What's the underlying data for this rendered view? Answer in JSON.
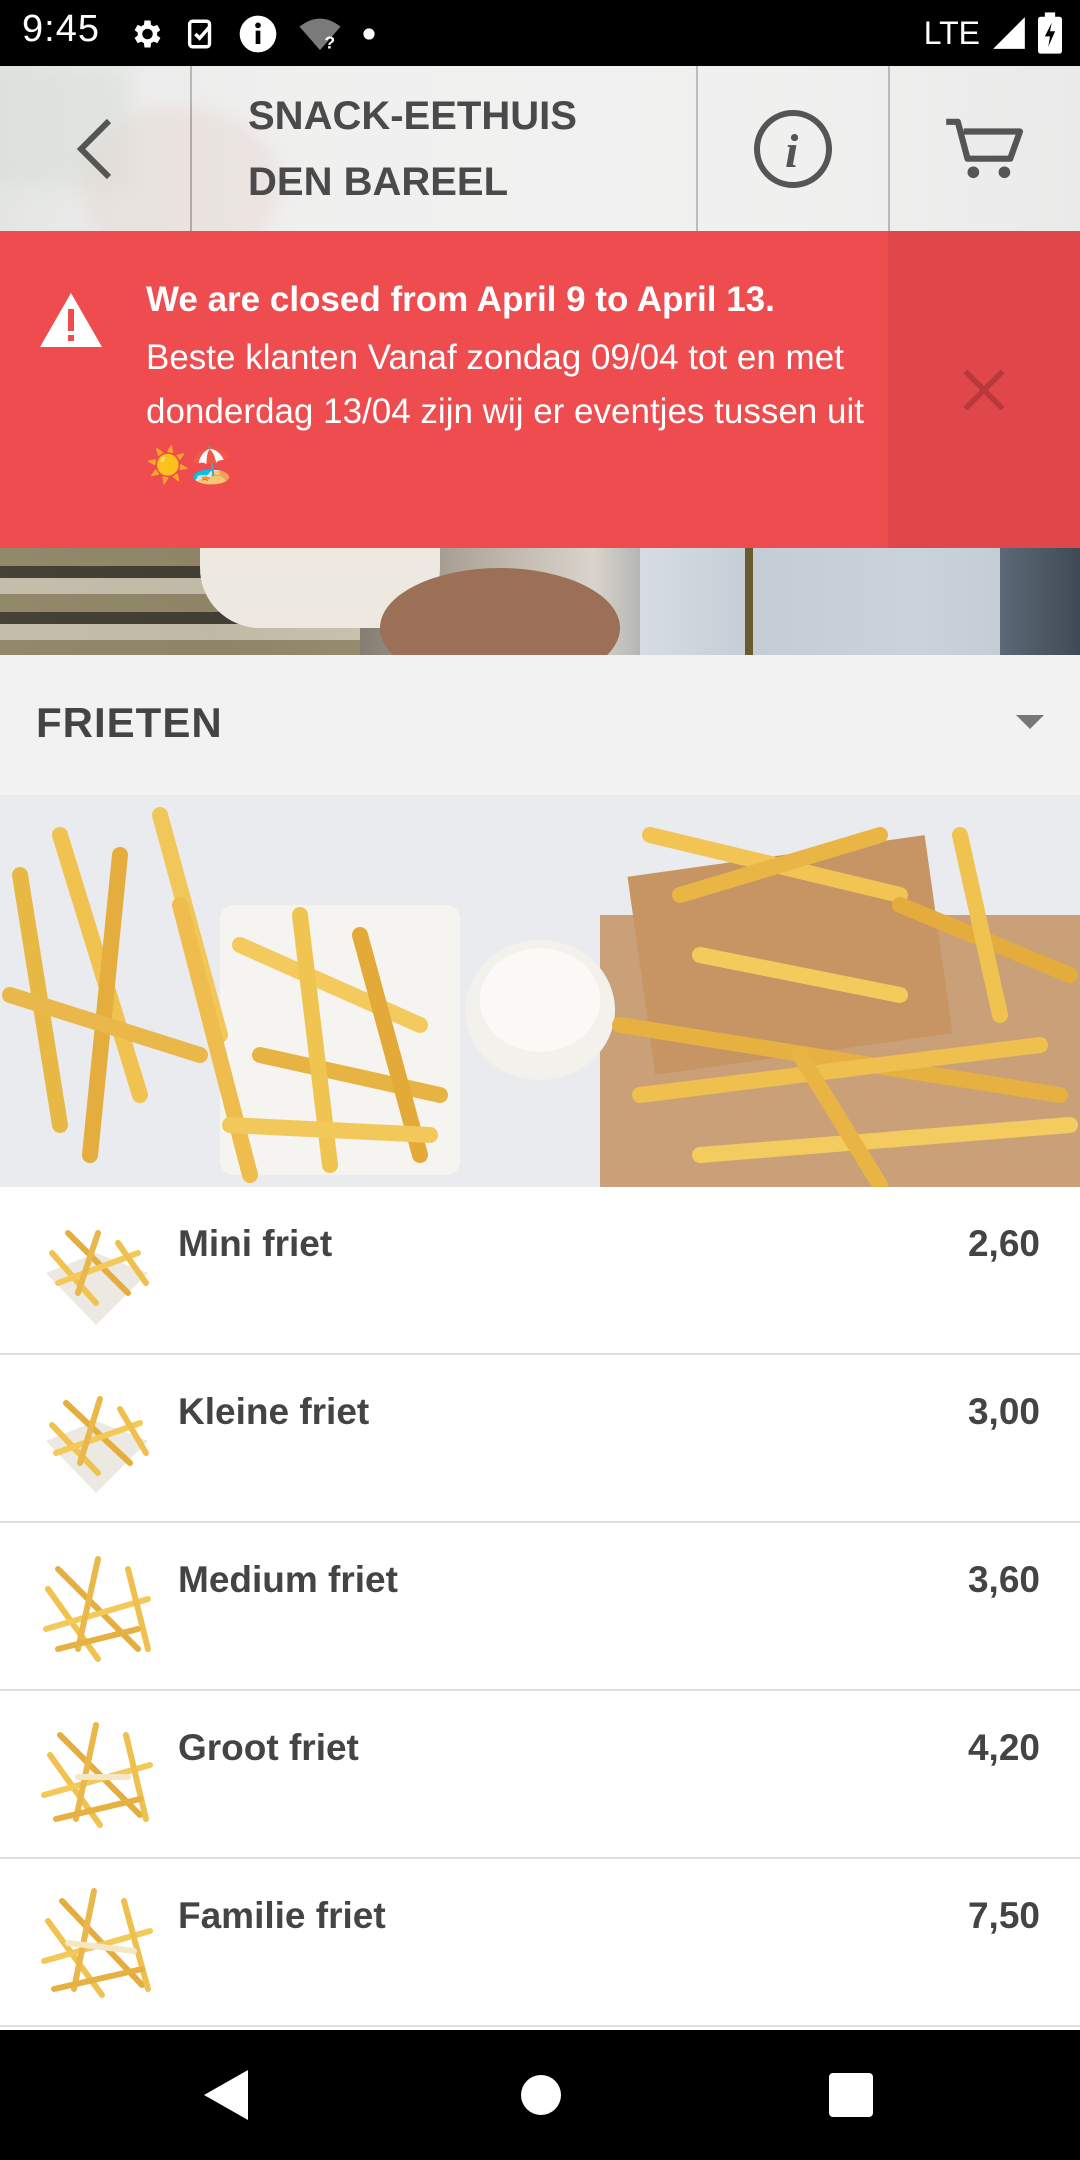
{
  "status_bar": {
    "time": "9:45",
    "network": "LTE",
    "icons": [
      "gear-icon",
      "clipboard-check-icon",
      "info-circle-icon",
      "wifi-question-icon",
      "dot-icon",
      "signal-icon",
      "battery-icon"
    ]
  },
  "header": {
    "title": "SNACK-EETHUIS\nDEN BAREEL",
    "back_icon": "chevron-left-icon",
    "info_icon": "info-icon",
    "cart_icon": "cart-icon"
  },
  "alert": {
    "title": "We are closed from April 9 to April 13.",
    "body": "Beste klanten Vanaf zondag 09/04 tot en met donderdag 13/04 zijn wij er eventjes tussen uit☀️🏖️",
    "background": "#ef4c4f",
    "close_icon": "close-icon",
    "warning_icon": "warning-icon"
  },
  "category": {
    "title": "FRIETEN",
    "toggle_icon": "dropdown-arrow-icon"
  },
  "items": [
    {
      "name": "Mini friet",
      "price": "2,60"
    },
    {
      "name": "Kleine friet",
      "price": "3,00"
    },
    {
      "name": "Medium friet",
      "price": "3,60"
    },
    {
      "name": "Groot friet",
      "price": "4,20"
    },
    {
      "name": "Familie friet",
      "price": "7,50"
    }
  ],
  "nav_bar": {
    "back_icon": "nav-back-icon",
    "home_icon": "nav-home-icon",
    "recents_icon": "nav-recents-icon"
  }
}
